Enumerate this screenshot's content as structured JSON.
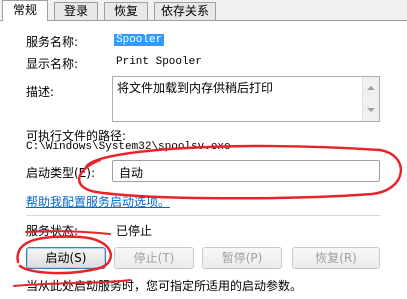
{
  "tabs": [
    {
      "label": "常规"
    },
    {
      "label": "登录"
    },
    {
      "label": "恢复"
    },
    {
      "label": "依存关系"
    }
  ],
  "fields": {
    "service_name_label": "服务名称:",
    "service_name_value": "Spooler",
    "display_name_label": "显示名称:",
    "display_name_value": "Print Spooler",
    "description_label": "描述:",
    "description_value": "将文件加载到内存供稍后打印",
    "exe_path_label": "可执行文件的路径:",
    "exe_path_value": "C:\\Windows\\System32\\spoolsv.exe",
    "startup_type_label": "启动类型(E):",
    "startup_type_value": "自动",
    "help_link": "帮助我配置服务启动选项。",
    "status_label": "服务状态:",
    "status_value": "已停止",
    "hint_text": "当从此处启动服务时，您可指定所适用的启动参数。"
  },
  "buttons": {
    "start": "启动(S)",
    "stop": "停止(T)",
    "pause": "暂停(P)",
    "resume": "恢复(R)"
  },
  "colors": {
    "annotation": "#e8242b",
    "selection": "#3399ff",
    "link": "#0066cc"
  }
}
